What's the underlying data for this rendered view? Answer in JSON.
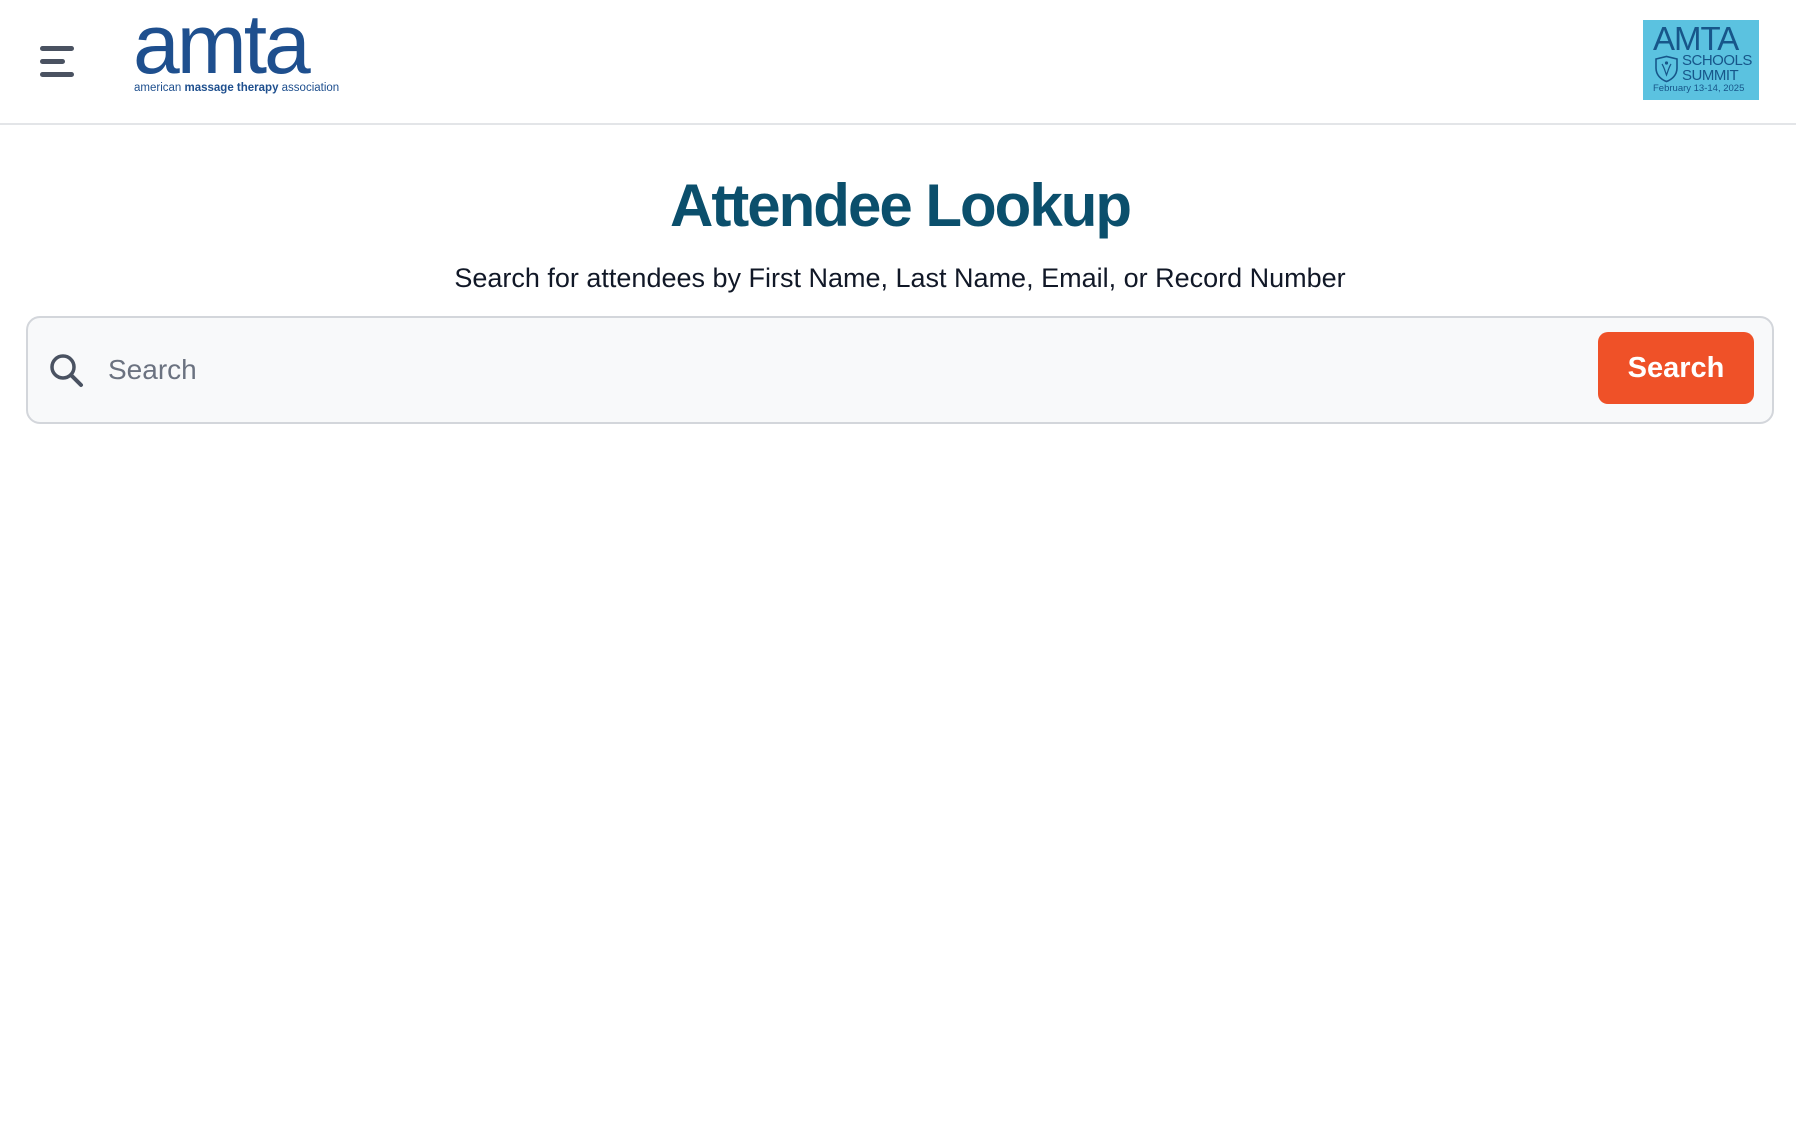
{
  "header": {
    "logo": {
      "wordmark": "amta",
      "tagline_prefix": "american ",
      "tagline_bold": "massage therapy",
      "tagline_suffix": " association"
    },
    "summit_badge": {
      "title": "AMTA",
      "line2": "SCHOOLS",
      "line3": "SUMMIT",
      "date": "February 13-14, 2025"
    }
  },
  "main": {
    "title": "Attendee Lookup",
    "subtitle": "Search for attendees by First Name, Last Name, Email, or Record Number",
    "search": {
      "placeholder": "Search",
      "value": "",
      "button_label": "Search"
    }
  },
  "colors": {
    "title": "#0b4f6c",
    "brand_blue": "#1e4f8e",
    "accent_orange": "#ef5128",
    "badge_bg": "#5bc2e0"
  },
  "icons": {
    "menu": "hamburger-menu-icon",
    "search": "search-icon",
    "badge_shield": "shield-icon"
  }
}
